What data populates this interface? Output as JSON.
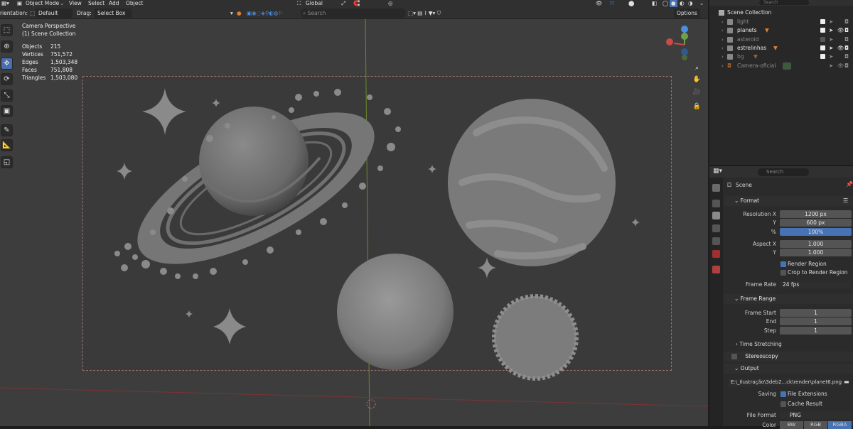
{
  "header": {
    "mode": "Object Mode",
    "menus": [
      "View",
      "Select",
      "Add",
      "Object"
    ],
    "orientation_label": "rientation:",
    "orientation_value": "Default",
    "drag_label": "Drag:",
    "drag_value": "Select Box",
    "transform": "Global",
    "search_placeholder": "Search",
    "options": "Options"
  },
  "viewport": {
    "info_title": "Camera Perspective",
    "info_collection": "(1) Scene Collection",
    "stats": [
      {
        "label": "Objects",
        "value": "215"
      },
      {
        "label": "Vertices",
        "value": "751,572"
      },
      {
        "label": "Edges",
        "value": "1,503,348"
      },
      {
        "label": "Faces",
        "value": "751,808"
      },
      {
        "label": "Triangles",
        "value": "1,503,080"
      }
    ]
  },
  "outliner": {
    "search_placeholder": "Search",
    "root": "Scene Collection",
    "items": [
      {
        "label": "light",
        "dim": true
      },
      {
        "label": "planets",
        "dim": false
      },
      {
        "label": "asteroid",
        "dim": true
      },
      {
        "label": "estrelinhas",
        "dim": false
      },
      {
        "label": "bg",
        "dim": true
      },
      {
        "label": "Camera-oficial",
        "dim": true
      }
    ]
  },
  "properties": {
    "search_placeholder": "Search",
    "scene_label": "Scene",
    "format_title": "Format",
    "resolution_x_label": "Resolution X",
    "resolution_x": "1200 px",
    "y_label": "Y",
    "resolution_y": "600 px",
    "percent_label": "%",
    "percent": "100%",
    "aspect_x_label": "Aspect X",
    "aspect_x": "1.000",
    "aspect_y_label": "Y",
    "aspect_y": "1.000",
    "render_region": "Render Region",
    "crop_region": "Crop to Render Region",
    "frame_rate_label": "Frame Rate",
    "frame_rate": "24 fps",
    "frame_range_title": "Frame Range",
    "frame_start_label": "Frame Start",
    "frame_start": "1",
    "end_label": "End",
    "end": "1",
    "step_label": "Step",
    "step": "1",
    "time_stretching": "Time Stretching",
    "stereoscopy": "Stereoscopy",
    "output_title": "Output",
    "output_path": "E:\\_Ilustração\\3deb2...ck\\render\\planet6.png",
    "saving_label": "Saving",
    "file_extensions": "File Extensions",
    "cache_result": "Cache Result",
    "file_format_label": "File Format",
    "file_format": "PNG",
    "color_label": "Color",
    "color_modes": [
      "BW",
      "RGB",
      "RGBA"
    ]
  }
}
